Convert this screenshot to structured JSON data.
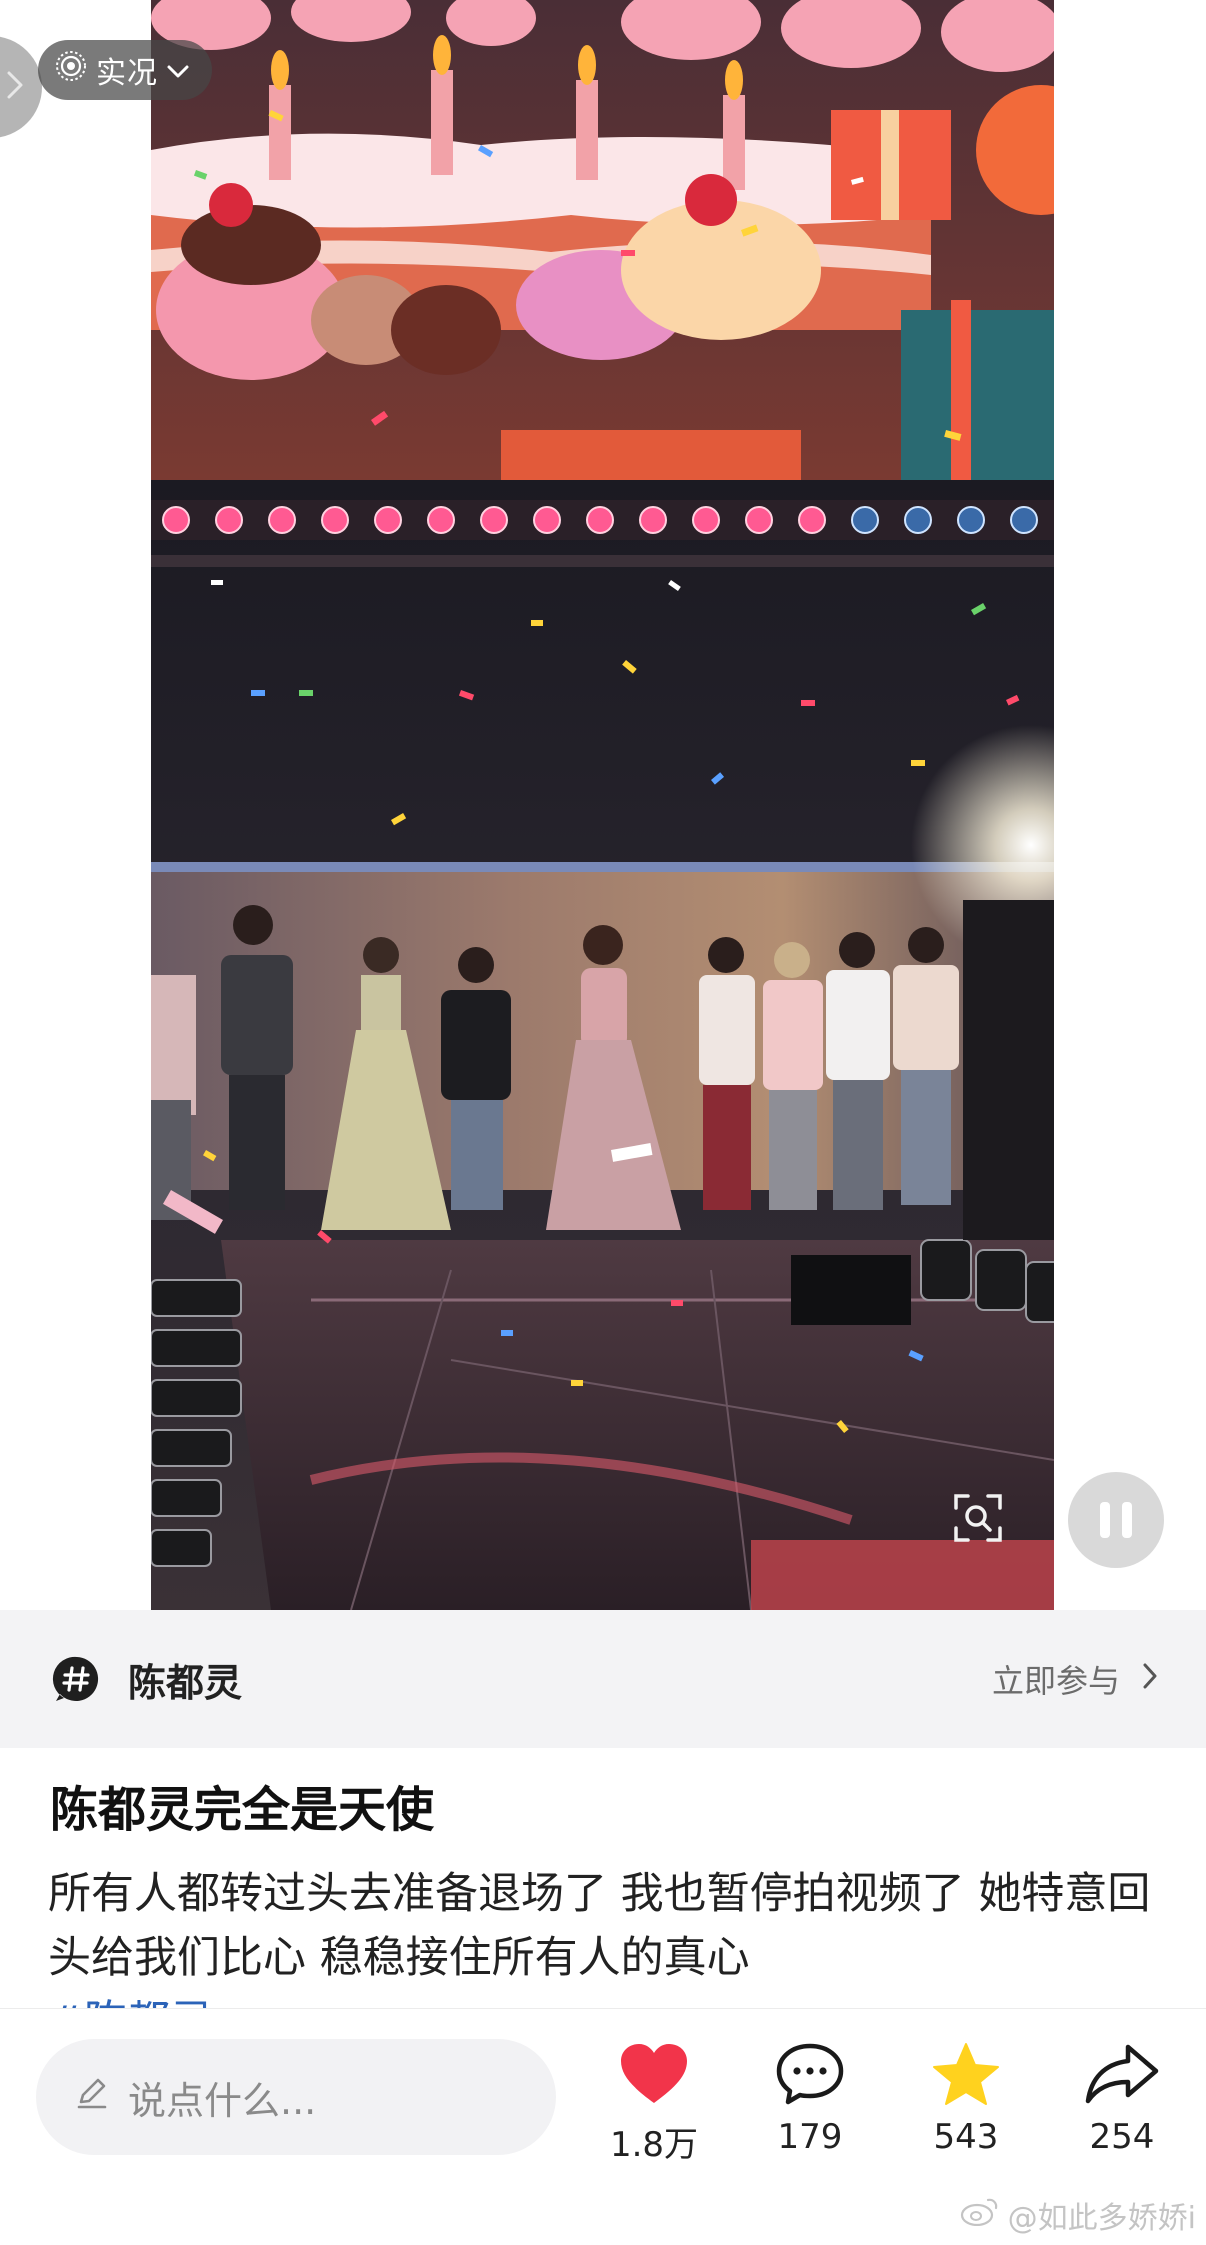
{
  "media": {
    "live_label": "实况",
    "icons": {
      "back": "chevron-right-icon",
      "live": "live-photo-icon",
      "dropdown": "chevron-down-icon",
      "scan": "image-search-icon",
      "pause": "pause-icon"
    }
  },
  "topic": {
    "name": "陈都灵",
    "join_label": "立即参与",
    "icons": {
      "topic": "hashtag-icon",
      "arrow": "chevron-right-icon"
    }
  },
  "post": {
    "title": "陈都灵完全是天使",
    "body": "所有人都转过头去准备退场了 我也暂停拍视频了 她特意回头给我们比心 稳稳接住所有人的真心",
    "hashtag": "#陈都灵"
  },
  "actions": {
    "comment_placeholder": "说点什么...",
    "like_count": "1.8万",
    "comment_count": "179",
    "favorite_count": "543",
    "share_count": "254",
    "icons": {
      "edit": "pencil-icon",
      "like": "heart-icon",
      "comment": "chat-bubble-icon",
      "favorite": "star-icon",
      "share": "share-arrow-icon"
    }
  },
  "watermark": {
    "text": "@如此多娇娇i",
    "icon": "weibo-logo-icon"
  },
  "colors": {
    "like_red": "#f2344a",
    "star_yellow": "#ffd21e",
    "hashtag_blue": "#2b63b8",
    "topic_bar_bg": "#f3f3f5"
  }
}
